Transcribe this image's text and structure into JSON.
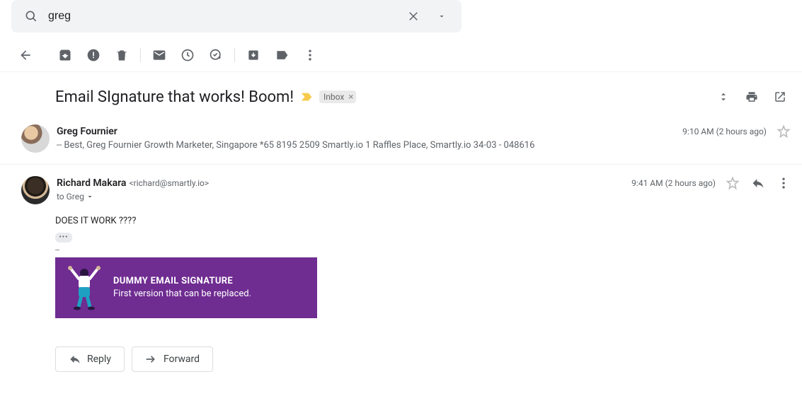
{
  "search": {
    "value": "greg"
  },
  "subject": {
    "text": "Email SIgnature that works! Boom!",
    "label": "Inbox"
  },
  "msg1": {
    "sender": "Greg Fournier",
    "snippet": "-- Best, Greg Fournier Growth Marketer, Singapore *65 8195 2509 Smartly.io 1 Raffles Place, Smartly.io 34-03 - 048616",
    "time": "9:10 AM (2 hours ago)"
  },
  "msg2": {
    "sender": "Richard Makara",
    "email": "<richard@smartly.io>",
    "to": "to Greg",
    "time": "9:41 AM (2 hours ago)",
    "body": "DOES IT WORK ????",
    "sig_title": "DUMMY EMAIL SIGNATURE",
    "sig_sub": "First version that can be replaced."
  },
  "actions": {
    "reply": "Reply",
    "forward": "Forward"
  }
}
